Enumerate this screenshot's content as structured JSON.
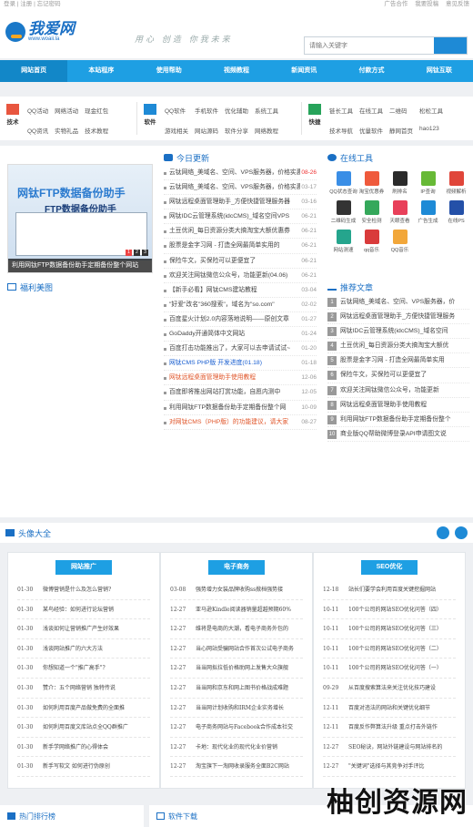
{
  "topbar": {
    "left": "登录 | 注册 | 忘记密码",
    "right": [
      "广告合作",
      "我要投稿",
      "意见反馈"
    ]
  },
  "logo": {
    "name": "我爱网",
    "url": "www.woaii.la"
  },
  "slogan": "用心 创造 你我未来",
  "search": {
    "placeholder": "请输入关键字"
  },
  "nav": [
    "网站首页",
    "本站程序",
    "使用帮助",
    "视频教程",
    "新闻资讯",
    "付款方式",
    "网钛互联"
  ],
  "linkgroups": [
    {
      "icon": "技术",
      "color": "#e8563f",
      "items": [
        "QQ活动",
        "网络活动",
        "现金红包",
        "QQ资讯",
        "实物礼品",
        "技术教程"
      ]
    },
    {
      "icon": "软件",
      "color": "#1e8ad6",
      "items": [
        "QQ软件",
        "手机软件",
        "优化辅助",
        "系统工具",
        "游戏相关",
        "网站源码",
        "软件分享",
        "网络教程"
      ]
    },
    {
      "icon": "快捷",
      "color": "#27a35a",
      "items": [
        "链长工具",
        "在线工具",
        "二维码",
        "松松工具",
        "技术导航",
        "优量软件",
        "静网首页",
        "hao123"
      ]
    }
  ],
  "slideshow": {
    "caption": "利用网钛FTP数据备份助手定期备份整个网站",
    "screen_title": "网钛FTP数据备份助手",
    "screen_sub": "FTP数据备份助手",
    "pages": [
      "1",
      "2",
      "3"
    ]
  },
  "welfare": {
    "title": "福利美图"
  },
  "today": {
    "title": "今日更新",
    "items": [
      {
        "t": "云钛网络_美域名、空间、VPS服务器，价格实惠",
        "d": "08-26",
        "red": true
      },
      {
        "t": "云钛网络_美域名、空间、VPS服务器，价格实惠",
        "d": "03-17"
      },
      {
        "t": "网钛远程桌面管理助手_方便快捷管理服务器",
        "d": "03-16"
      },
      {
        "t": "网钛IDC云管理系统(idcCMS)_域名空间VPS",
        "d": "06-21"
      },
      {
        "t": "土豆优闲_每日资源分类大搞淘宝大额优惠券",
        "d": "06-21"
      },
      {
        "t": "股票是金字习网 - 打造全网最简单实用的",
        "d": "06-21"
      },
      {
        "t": "保险牛文，买保险可以更便宜了",
        "d": "06-21"
      },
      {
        "t": "欢迎关注网钛微信公众号，功能更新(04.06)",
        "d": "06-21"
      },
      {
        "t": "【新手必看】网钛CMS建站教程",
        "d": "03-04"
      },
      {
        "t": "\"好爱\"改名\"360搜索\"，域名为\"so.com\"",
        "d": "02-02"
      },
      {
        "t": "百度星火计划2.0内容落地说明——原创文章",
        "d": "01-27"
      },
      {
        "t": "GoDaddy开通简体中文网站",
        "d": "01-24"
      },
      {
        "t": "百度打击功能推出了，大家可以去申请试试~",
        "d": "01-20"
      },
      {
        "t": "网钛CMS PHP版 开发进度(01.18)",
        "d": "01-18",
        "blue": true
      },
      {
        "t": "网钛远程桌面管理助手使用教程",
        "d": "12-06",
        "orange": true
      },
      {
        "t": "百度即将推出网站打赏功能，自愿内测中",
        "d": "12-05"
      },
      {
        "t": "利用网钛FTP数据备份助手定期备份整个网",
        "d": "10-09"
      },
      {
        "t": "对网钛CMS（PHP版）的功能建议，请大家",
        "d": "08-27",
        "orange": true
      }
    ]
  },
  "tools": {
    "title": "在线工具",
    "items": [
      {
        "n": "QQ状态查询",
        "c": "#3a8ee6"
      },
      {
        "n": "淘宝优惠券",
        "c": "#ef5a3c"
      },
      {
        "n": "刷排名",
        "c": "#2b2b2b"
      },
      {
        "n": "IP查询",
        "c": "#67b936"
      },
      {
        "n": "视频解析",
        "c": "#e0463a"
      },
      {
        "n": "二维码生成",
        "c": "#333"
      },
      {
        "n": "安全检测",
        "c": "#35a85b"
      },
      {
        "n": "天眼查看",
        "c": "#e8405a"
      },
      {
        "n": "广告生成",
        "c": "#1e8ad6"
      },
      {
        "n": "在线PS",
        "c": "#2450a8"
      },
      {
        "n": "网站测速",
        "c": "#25a58d"
      },
      {
        "n": "qq音乐",
        "c": "#d93b3b"
      },
      {
        "n": "QQ音乐",
        "c": "#f2a73a"
      }
    ]
  },
  "recommend": {
    "title": "推荐文章",
    "items": [
      "云钛网络_美域名、空间、VPS服务器，价",
      "网钛远程桌面管理助手_方便快捷管理服务",
      "网钛IDC云管理系统(idcCMS)_域名空间",
      "土豆优闲_每日资源分类大搞淘宝大额优",
      "股票是金字习网 - 打造全网最简单实用",
      "保险牛文，买保险可以更便宜了",
      "欢迎关注网钛微信公众号，功能更新",
      "网钛远程桌面管理助手使用教程",
      "利用网钛FTP数据备份助手定期备份整个",
      "商业版QQ帮助微博登录API申请图文说"
    ]
  },
  "headbanner": {
    "title": "头像大全"
  },
  "columns": [
    {
      "title": "网站推广",
      "rows": [
        {
          "d": "01-30",
          "t": "微博营销是什么及怎么营销?"
        },
        {
          "d": "01-30",
          "t": "某鸟经验：如何进行论坛营销"
        },
        {
          "d": "01-30",
          "t": "浅谈如何让营销推广产生好效果"
        },
        {
          "d": "01-30",
          "t": "浅谈网站推广的六大方法"
        },
        {
          "d": "01-30",
          "t": "你想知道一个\"推广高手\"?"
        },
        {
          "d": "01-30",
          "t": "赞介：五个网络营销 独特传说"
        },
        {
          "d": "01-30",
          "t": "如何利用百度产品做免费的全面推"
        },
        {
          "d": "01-30",
          "t": "如何利用百度文库站点全QQ群推广"
        },
        {
          "d": "01-30",
          "t": "新手学网络推广的心得体会"
        },
        {
          "d": "01-30",
          "t": "新手写软文 如何进行伪原创"
        }
      ]
    },
    {
      "title": "电子商务",
      "rows": [
        {
          "d": "03-08",
          "t": "强势增力女装品牌收购ss掀档强势接"
        },
        {
          "d": "12-27",
          "t": "亚马逊Kindle阅读器销量超越预期60%"
        },
        {
          "d": "12-27",
          "t": "维将是电商的大潮，看电子商务外包的"
        },
        {
          "d": "12-27",
          "t": "当心网站受骗网站合作首次公试电子商务"
        },
        {
          "d": "12-27",
          "t": "当当网拟拉低价格助网上发售大众旗舰"
        },
        {
          "d": "12-27",
          "t": "当当网和京东和网上图书价格战成难题"
        },
        {
          "d": "12-27",
          "t": "当当网计划收购和IRM企业实务增长"
        },
        {
          "d": "12-27",
          "t": "电子商务网站与Facebook合作成本社交"
        },
        {
          "d": "12-27",
          "t": "卡地：现代化业的现代化业价营销"
        },
        {
          "d": "12-27",
          "t": "淘宝旗下一淘网收录服务全面B2C网站"
        }
      ]
    },
    {
      "title": "SEO优化",
      "rows": [
        {
          "d": "12-18",
          "t": "站长们要学会利用百度关键挖掘网站"
        },
        {
          "d": "10-11",
          "t": "100个公司的网站SEO优化问答（四）"
        },
        {
          "d": "10-11",
          "t": "100个公司的网站SEO优化问答（三）"
        },
        {
          "d": "10-11",
          "t": "100个公司的网站SEO优化问答（二）"
        },
        {
          "d": "10-11",
          "t": "100个公司的网站SEO优化问答（一）"
        },
        {
          "d": "09-29",
          "t": "从百度搜索算法来关注优化技巧建设"
        },
        {
          "d": "12-11",
          "t": "百度对违法的网站和关键优化细节"
        },
        {
          "d": "12-11",
          "t": "百度反作弊算法升级 重点打击外链作"
        },
        {
          "d": "12-27",
          "t": "SEO秘诀，网站外链建设与网站排名的"
        },
        {
          "d": "12-27",
          "t": "\"关键词\"选择与其竞争对手评比"
        }
      ]
    }
  ],
  "footer": {
    "left": "热门排行榜",
    "right": "软件下载"
  },
  "watermark": "柚创资源网"
}
